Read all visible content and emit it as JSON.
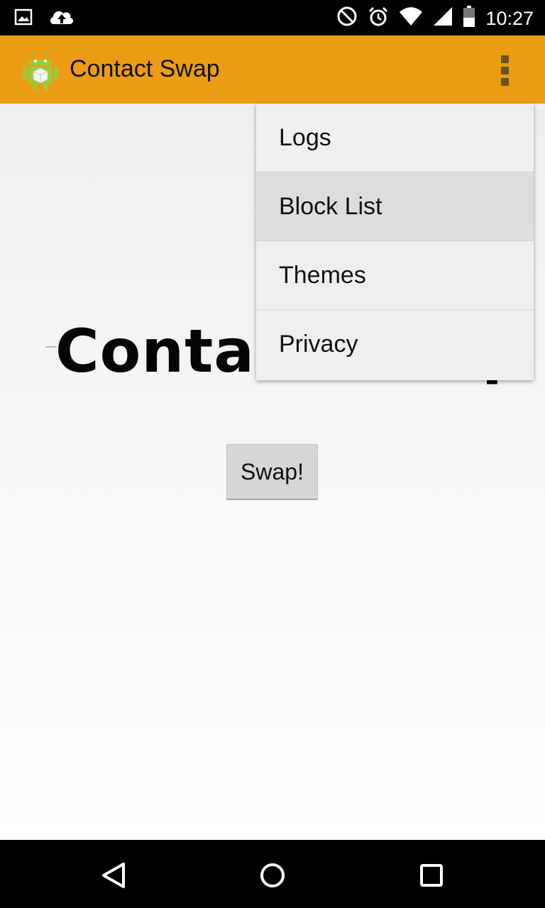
{
  "status_bar": {
    "time": "10:27",
    "left_icons": [
      "image-notification-icon",
      "cloud-upload-icon"
    ],
    "right_icons": [
      "do-not-disturb-icon",
      "alarm-icon",
      "wifi-icon",
      "signal-icon",
      "battery-icon"
    ]
  },
  "app_bar": {
    "title": "Contact Swap",
    "logo_icon": "android-app-icon",
    "overflow_icon": "more-vert-icon",
    "background_color": "#EB9C13"
  },
  "main": {
    "hero_title": "Contact Swap",
    "swap_button_label": "Swap!"
  },
  "overflow_menu": {
    "items": [
      {
        "label": "Logs"
      },
      {
        "label": "Block List",
        "highlighted": true
      },
      {
        "label": "Themes"
      },
      {
        "label": "Privacy"
      }
    ]
  },
  "nav_bar": {
    "buttons": [
      "back-icon",
      "home-icon",
      "recents-icon"
    ]
  }
}
